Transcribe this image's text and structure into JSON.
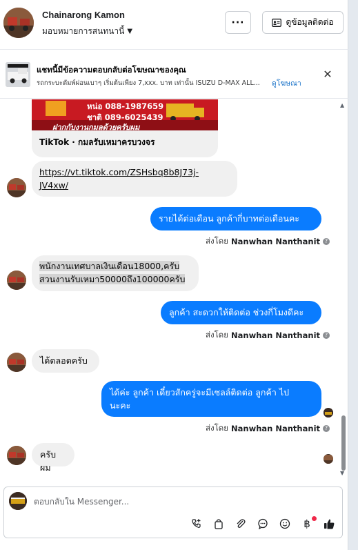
{
  "header": {
    "name": "Chainarong Kamon",
    "assign_label": "มอบหมายการสนทนานี้",
    "more_label": "···",
    "contact_label": "ดูข้อมูลติดต่อ"
  },
  "ad": {
    "title": "แชทนี้มีข้อความตอบกลับต่อโฆษณาของคุณ",
    "text": "รถกระบะดัมพ์ผ่อนเบาๆ เริ่มต้นเพียง 7,xxx. บาท เท่านั้น ISUZU D-MAX ALL...",
    "link": "ดูโฆษณา"
  },
  "card": {
    "phone1": "หน่อ 088-1987659",
    "phone2": "ชาติ 089-6025439",
    "banner": "ฝากกับงานกมลด้วยครับผม",
    "title": "TikTok · กมลรับเหมาครบวงจร"
  },
  "messages": [
    {
      "dir": "in",
      "text_line1": "https://vt.tiktok.com/ZSHsbq8b8J73j-",
      "text_line2": "JV4xw/"
    },
    {
      "dir": "out",
      "text": "รายได้ต่อเดือน  ลูกค้ากี่บาทต่อเดือนคะ"
    },
    {
      "dir": "in",
      "text_line1": "พนักงานเทศบาลเงินเดือน18000,ครับ",
      "text_line2": "สวนงานรับเหมา50000ถึง100000ครับ"
    },
    {
      "dir": "out",
      "text": "ลูกค้า สะดวกให้ติดต่อ ช่วงกี่โมงดีคะ"
    },
    {
      "dir": "in",
      "text": "ได้ตลอดครับ"
    },
    {
      "dir": "out",
      "text_line1": "ได้ค่ะ  ลูกค้า เดี๋ยวสักครู่จะมีเซลล์ติดต่อ ลูกค้า ไป",
      "text_line2": "นะคะ"
    },
    {
      "dir": "in",
      "text": "ครับผม"
    }
  ],
  "sent_by": {
    "prefix": "ส่งโดย",
    "name": "Nanwhan Nanthanit"
  },
  "composer": {
    "placeholder": "ตอบกลับใน Messenger..."
  },
  "colors": {
    "outgoing": "#0a7cff",
    "incoming": "#f0f0f0",
    "link": "#1a73c9"
  },
  "icons": [
    "phone-plus-icon",
    "bag-icon",
    "paperclip-icon",
    "chat-icon",
    "emoji-icon",
    "baht-icon",
    "thumbs-up-icon"
  ]
}
